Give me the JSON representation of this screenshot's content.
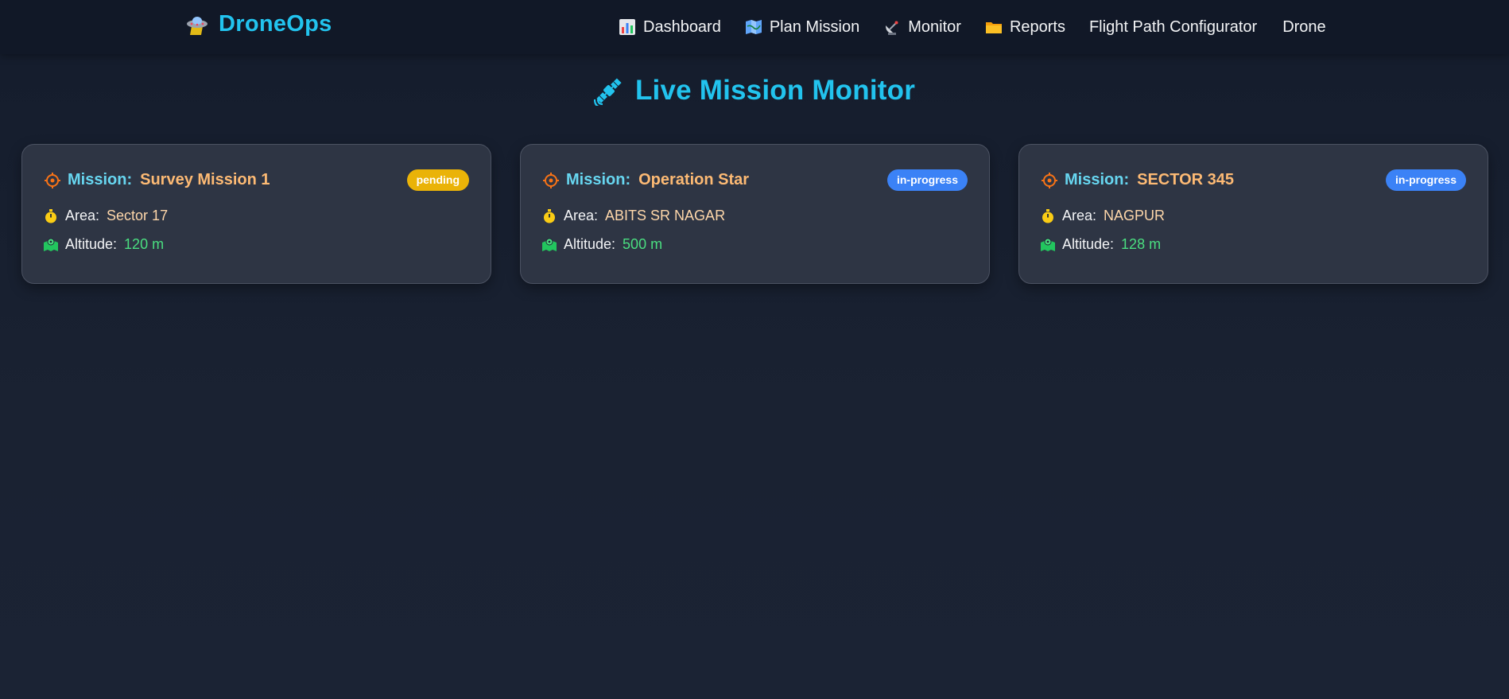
{
  "app": {
    "brand": "DroneOps"
  },
  "nav": {
    "items": [
      {
        "label": "Dashboard",
        "icon": "bar-chart-icon"
      },
      {
        "label": "Plan Mission",
        "icon": "map-icon"
      },
      {
        "label": "Monitor",
        "icon": "satellite-dish-icon"
      },
      {
        "label": "Reports",
        "icon": "folder-icon"
      },
      {
        "label": "Flight Path Configurator",
        "icon": ""
      },
      {
        "label": "Drone",
        "icon": ""
      }
    ]
  },
  "header": {
    "title": "Live Mission Monitor",
    "icon": "satellite-icon"
  },
  "missions": [
    {
      "label": "Mission:",
      "name": "Survey Mission 1",
      "status": "pending",
      "area_label": "Area:",
      "area": "Sector 17",
      "altitude_label": "Altitude:",
      "altitude": "120 m"
    },
    {
      "label": "Mission:",
      "name": "Operation Star",
      "status": "in-progress",
      "area_label": "Area:",
      "area": "ABITS SR NAGAR",
      "altitude_label": "Altitude:",
      "altitude": "500 m"
    },
    {
      "label": "Mission:",
      "name": "SECTOR 345",
      "status": "in-progress",
      "area_label": "Area:",
      "area": "NAGPUR",
      "altitude_label": "Altitude:",
      "altitude": "128 m"
    }
  ],
  "colors": {
    "accent": "#22c3ee",
    "mission_name": "#fdba74",
    "pending": "#eab308",
    "in_progress": "#3b82f6",
    "altitude": "#4ade80"
  }
}
